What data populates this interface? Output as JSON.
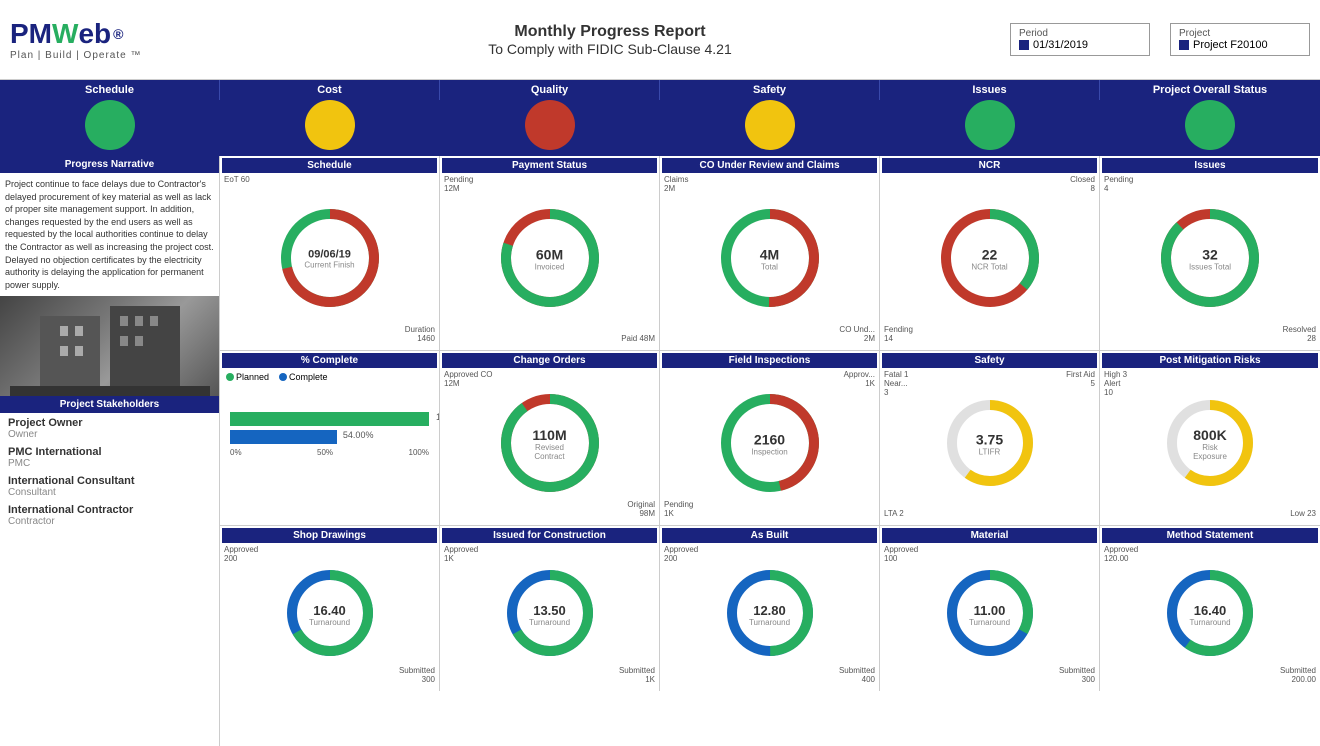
{
  "header": {
    "logo_main": "PMWeb",
    "logo_accent": "W",
    "logo_tagline": "Plan | Build | Operate ™",
    "title_line1": "Monthly Progress Report",
    "title_line2": "To Comply with FIDIC Sub-Clause 4.21",
    "period_label": "Period",
    "period_value": "01/31/2019",
    "project_label": "Project",
    "project_value": "Project F20100"
  },
  "status_bar": {
    "cells": [
      {
        "label": "Schedule",
        "color": "green"
      },
      {
        "label": "Cost",
        "color": "yellow"
      },
      {
        "label": "Quality",
        "color": "red"
      },
      {
        "label": "Safety",
        "color": "yellow"
      },
      {
        "label": "Issues",
        "color": "green"
      },
      {
        "label": "Project Overall Status",
        "color": "green"
      }
    ]
  },
  "sidebar": {
    "narrative_header": "Progress Narrative",
    "narrative_text": "Project continue to face delays due to Contractor's delayed procurement of key material as well as lack of proper site management support. In addition, changes requested by the end users as well as requested by the local authorities continue to delay the Contractor as well as increasing the project cost. Delayed no objection certificates by the electricity authority is delaying the application for permanent power supply.",
    "stakeholders_header": "Project Stakeholders",
    "stakeholders": [
      {
        "role": "Project Owner",
        "type": "Owner"
      },
      {
        "role": "PMC International",
        "type": "PMC"
      },
      {
        "role": "International Consultant",
        "type": "Consultant"
      },
      {
        "role": "International Contractor",
        "type": "Contractor"
      }
    ]
  },
  "panels": {
    "row2": [
      {
        "header": "Schedule",
        "value": "09/06/19",
        "sub": "Current Finish",
        "ann_tl": "EoT 60",
        "ann_bl": "",
        "ann_br": "Duration\n1460",
        "donut": {
          "pct": 72,
          "color_fill": "#c0392b",
          "color_bg": "#27ae60",
          "r": 50
        }
      },
      {
        "header": "Payment Status",
        "value": "60M",
        "sub": "Invoiced",
        "ann_tl": "Pending\n12M",
        "ann_br": "Paid 48M",
        "donut": {
          "pct": 80,
          "color_fill": "#27ae60",
          "color_bg": "#c0392b",
          "r": 50
        }
      },
      {
        "header": "CO Under Review and Claims",
        "value": "4M",
        "sub": "Total",
        "ann_tl": "Claims\n2M",
        "ann_br": "CO Und...\n2M",
        "donut": {
          "pct": 50,
          "color_fill": "#c0392b",
          "color_bg": "#27ae60",
          "r": 50
        }
      },
      {
        "header": "NCR",
        "value": "22",
        "sub": "NCR Total",
        "ann_tl": "Closed\n8",
        "ann_bl": "Fending\n14",
        "donut": {
          "pct": 36,
          "color_fill": "#27ae60",
          "color_bg": "#c0392b",
          "r": 50
        }
      },
      {
        "header": "Issues",
        "value": "32",
        "sub": "Issues Total",
        "ann_tl": "Pending\n4",
        "ann_br": "Resolved\n28",
        "donut": {
          "pct": 87,
          "color_fill": "#27ae60",
          "color_bg": "#c0392b",
          "r": 50
        }
      }
    ],
    "row3": [
      {
        "header": "% Complete",
        "type": "bar",
        "legend": [
          {
            "label": "Planned",
            "color": "#27ae60"
          },
          {
            "label": "Complete",
            "color": "#1565c0"
          }
        ],
        "planned_pct": 100,
        "complete_pct": 54,
        "complete_label": "54.00%",
        "axis": [
          "0%",
          "50%",
          "100%"
        ]
      },
      {
        "header": "Change Orders",
        "value": "110M",
        "sub": "Revised Contract",
        "ann_tl": "Approved CO\n12M",
        "ann_br": "Original\n98M",
        "donut": {
          "pct": 89,
          "color_fill": "#27ae60",
          "color_bg": "#c0392b",
          "r": 50
        }
      },
      {
        "header": "Field Inspections",
        "value": "2160",
        "sub": "Inspection",
        "ann_tl": "Approv...\n1K",
        "ann_bl": "Pending\n1K",
        "donut": {
          "pct": 46,
          "color_fill": "#c0392b",
          "color_bg": "#27ae60",
          "r": 50
        }
      },
      {
        "header": "Safety",
        "value": "3.75",
        "sub": "LTIFR",
        "ann_tl": "Fatal 1",
        "ann_tl2": "Near...\n3",
        "ann_tr": "First Aid\n5",
        "ann_bl": "LTA 2",
        "donut": {
          "pct": 60,
          "color_fill": "#f1c40f",
          "color_bg": "#e0e0e0",
          "r": 50
        }
      },
      {
        "header": "Post Mitigation Risks",
        "value": "800K",
        "sub": "Risk Exposure",
        "ann_tl": "High 3",
        "ann_tl2": "Alert\n10",
        "ann_br": "Low 23",
        "donut": {
          "pct": 60,
          "color_fill": "#f1c40f",
          "color_bg": "#e0e0e0",
          "r": 50
        }
      }
    ],
    "row4": [
      {
        "header": "Shop Drawings",
        "value": "16.40",
        "sub": "Turnaround",
        "ann_tl": "Approved\n200",
        "ann_br": "Submitted\n300",
        "donut": {
          "pct": 67,
          "color_fill": "#27ae60",
          "color_bg": "#1565c0",
          "r": 50
        }
      },
      {
        "header": "Issued for Construction",
        "value": "13.50",
        "sub": "Turnaround",
        "ann_tl": "Approved\n1K",
        "ann_br": "Submitted\n1K",
        "donut": {
          "pct": 67,
          "color_fill": "#27ae60",
          "color_bg": "#1565c0",
          "r": 50
        }
      },
      {
        "header": "As Built",
        "value": "12.80",
        "sub": "Turnaround",
        "ann_tl": "Approved\n200",
        "ann_br": "Submitted\n400",
        "donut": {
          "pct": 50,
          "color_fill": "#27ae60",
          "color_bg": "#1565c0",
          "r": 50
        }
      },
      {
        "header": "Material",
        "value": "11.00",
        "sub": "Turnaround",
        "ann_tl": "Approved\n100",
        "ann_br": "Submitted\n300",
        "donut": {
          "pct": 33,
          "color_fill": "#27ae60",
          "color_bg": "#1565c0",
          "r": 50
        }
      },
      {
        "header": "Method Statement",
        "value": "16.40",
        "sub": "Turnaround",
        "ann_tl": "Approved\n120.00",
        "ann_br": "Submitted\n200.00",
        "donut": {
          "pct": 60,
          "color_fill": "#27ae60",
          "color_bg": "#1565c0",
          "r": 50
        }
      }
    ]
  }
}
